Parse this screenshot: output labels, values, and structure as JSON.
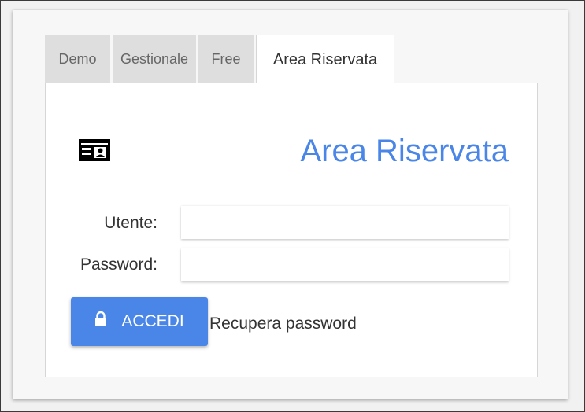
{
  "tabs": [
    {
      "label": "Demo",
      "active": false
    },
    {
      "label": "Gestionale",
      "active": false
    },
    {
      "label": "Free",
      "active": false
    },
    {
      "label": "Area Riservata",
      "active": true
    }
  ],
  "panel": {
    "title": "Area Riservata",
    "icon": "id-card-icon"
  },
  "form": {
    "user_label": "Utente:",
    "user_value": "",
    "password_label": "Password:",
    "password_value": ""
  },
  "actions": {
    "login_label": "ACCEDI",
    "login_icon": "lock-icon",
    "recover_label": "Recupera password"
  },
  "colors": {
    "accent": "#4a86e8",
    "tab_inactive": "#dedede"
  }
}
